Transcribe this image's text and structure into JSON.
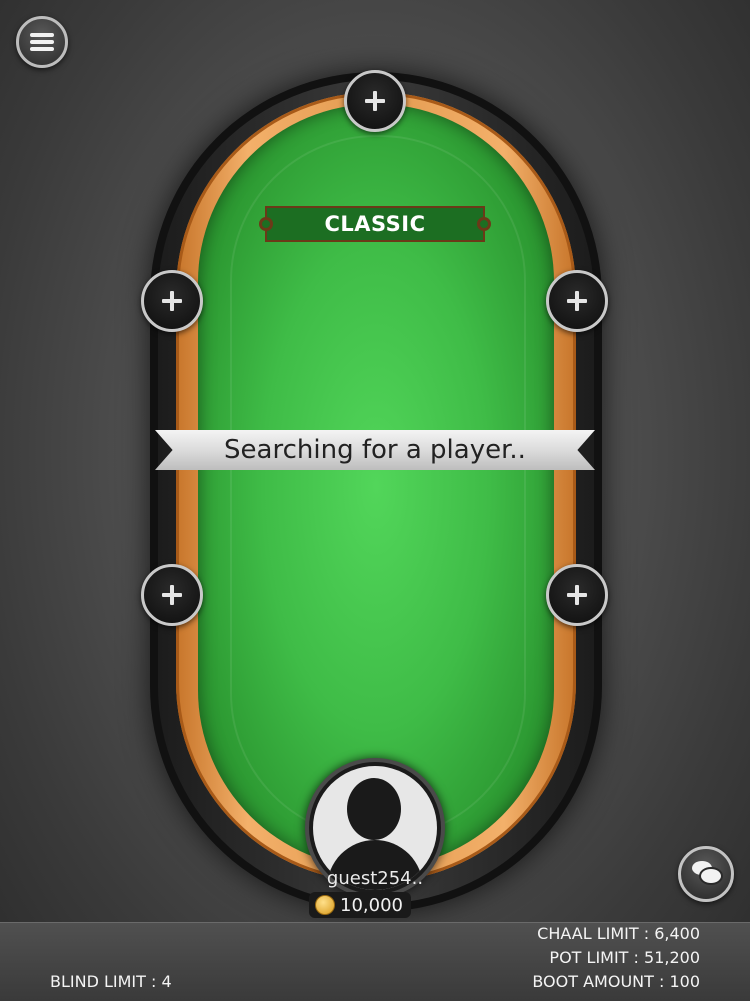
{
  "table": {
    "mode_label": "CLASSIC",
    "status_text": "Searching for a player..",
    "felt_color": "#3fbc47",
    "rail_color": "#e39a4f"
  },
  "player": {
    "name": "guest254..",
    "chips": "10,000"
  },
  "seats": [
    {
      "icon": "plus-icon",
      "state": "empty"
    },
    {
      "icon": "plus-icon",
      "state": "empty"
    },
    {
      "icon": "plus-icon",
      "state": "empty"
    },
    {
      "icon": "plus-icon",
      "state": "empty"
    },
    {
      "icon": "plus-icon",
      "state": "empty"
    }
  ],
  "limits": {
    "chaal": "CHAAL LIMIT : 6,400",
    "pot": "POT LIMIT : 51,200",
    "boot": "BOOT AMOUNT : 100",
    "blind": "BLIND LIMIT : 4"
  },
  "icons": {
    "menu": "hamburger-icon",
    "chat": "chat-bubbles-icon",
    "coin": "coin-icon"
  }
}
